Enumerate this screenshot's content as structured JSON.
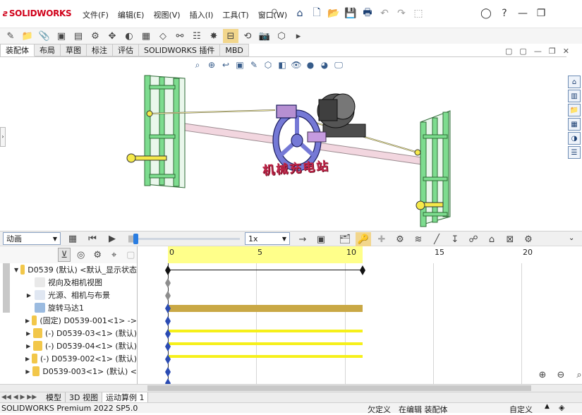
{
  "app": {
    "brand": "SOLIDWORKS",
    "menu": [
      "文件(F)",
      "编辑(E)",
      "视图(V)",
      "插入(I)",
      "工具(T)",
      "窗口(W)"
    ]
  },
  "tabs": [
    "装配体",
    "布局",
    "草图",
    "标注",
    "评估",
    "SOLIDWORKS 插件",
    "MBD"
  ],
  "viewport": {
    "annotation": "机械充电站"
  },
  "animation": {
    "mode": "动画",
    "playback_speed": "1x"
  },
  "timeline": {
    "ticks": [
      "0",
      "5",
      "10",
      "15",
      "20"
    ]
  },
  "tree": {
    "root": "D0539 (默认) <默认_显示状态",
    "items": [
      "视向及相机视图",
      "光源、相机与布景",
      "旋转马达1",
      "(固定) D0539-001<1> ->",
      "(-) D0539-03<1> (默认)",
      "(-) D0539-04<1> (默认)",
      "(-) D0539-002<1> (默认)",
      "D0539-003<1> (默认) <"
    ]
  },
  "bottom_tabs": [
    "模型",
    "3D 视图",
    "运动算例 1"
  ],
  "status": {
    "product": "SOLIDWORKS Premium 2022 SP5.0",
    "defined": "欠定义",
    "editing": "在编辑 装配体",
    "custom": "自定义"
  },
  "colors": {
    "accent_blue": "#1a3e72",
    "timeline_yellow": "#ffff8a",
    "motor_bar": "#c9a845",
    "key_bar": "#f6f01a",
    "frame_green": "#33b85a",
    "wheel_purple": "#7579d6",
    "brand_red": "#d0021b"
  }
}
